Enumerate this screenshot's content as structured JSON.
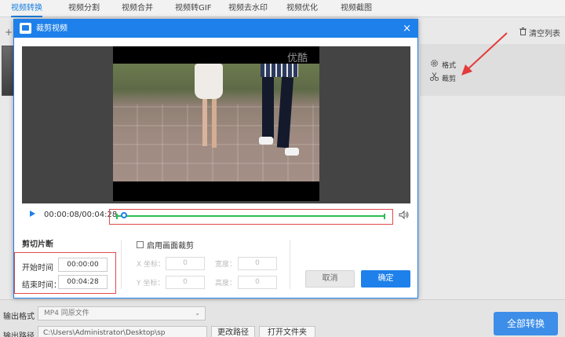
{
  "app": {
    "tabs": [
      {
        "label": "视频转换",
        "active": true
      },
      {
        "label": "视频分割"
      },
      {
        "label": "视频合并"
      },
      {
        "label": "视频转GIF"
      },
      {
        "label": "视频去水印"
      },
      {
        "label": "视频优化"
      },
      {
        "label": "视频截图"
      }
    ],
    "add_symbol": "+",
    "clear_list_label": "清空列表",
    "right_panel": {
      "format_label": "格式",
      "crop_label": "裁剪"
    }
  },
  "dialog": {
    "title": "裁剪视频",
    "close_glyph": "×",
    "video": {
      "watermark": "优酷",
      "current_time": "00:00:08",
      "total_time": "00:04:28",
      "timecode_display": "00:00:08/00:04:28",
      "progress_fraction": 0.03
    },
    "cut_section": {
      "title": "剪切片断",
      "start_label": "开始时间",
      "start_value": "00:00:00",
      "end_label": "结束时间：",
      "end_value": "00:04:28"
    },
    "crop_section": {
      "enable_label": "启用画面裁剪",
      "enabled": false,
      "x_label": "X 坐标：",
      "x_value": "0",
      "width_label": "宽度：",
      "width_value": "0",
      "y_label": "Y 坐标：",
      "y_value": "0",
      "height_label": "高度：",
      "height_value": "0"
    },
    "cancel_label": "取消",
    "ok_label": "确定"
  },
  "bottom": {
    "format_label": "输出格式",
    "format_value": "MP4  同原文件",
    "path_label": "输出路径",
    "path_value": "C:\\Users\\Administrator\\Desktop\\sp",
    "change_path_label": "更改路径",
    "open_folder_label": "打开文件夹",
    "convert_all_label": "全部转换"
  },
  "colors": {
    "accent": "#1e80ea",
    "highlight_border": "#e14b4b",
    "track_green": "#2cbd55"
  }
}
